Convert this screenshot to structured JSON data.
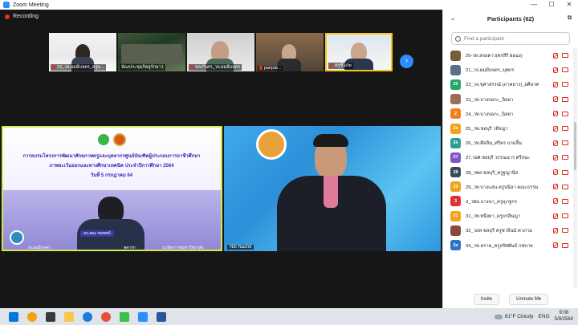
{
  "window": {
    "title": "Zoom Meeting",
    "controls": [
      "—",
      "☐",
      "✕"
    ]
  },
  "recording": {
    "label": "Recording"
  },
  "thumbnails": [
    {
      "label": "23_วจ.ผมมีบจคร_ครูบ...",
      "muted": true
    },
    {
      "label": "ห้องประชุมกิตฮูรักษา1",
      "muted": false
    },
    {
      "label": "ของวิเคร_วจ.ผมมีบจคร",
      "muted": true
    },
    {
      "label": "panpat...",
      "muted": true
    },
    {
      "label": "ครูชีวภพ",
      "muted": true
    }
  ],
  "next_page_symbol": "›",
  "shared_slide": {
    "line1": "การอบรมโครงการพัฒนาศักยภาพครูและบุคลากรศูนย์บัณฑิตผู้ประกอบการอาชีวศึกษา",
    "line2": "ภาพละเว้นออกและทางศึกษาเทคนิค ประจำปีการศึกษา 2564",
    "line3": "วันที่ 5 กรกฎาคม 64",
    "presenter_caption": "นร.ผดุง ชลทศน์",
    "ticker_left": "วจ.ผมมีบจคร",
    "ticker_mid": "พคาชา",
    "ticker_right": "นามิตรราชมหาวิทยาลัย"
  },
  "speaker": {
    "name": "Niti Nachit"
  },
  "participants_panel": {
    "title": "Participants (62)",
    "search_placeholder": "Find a participant",
    "items": [
      {
        "badge": "",
        "badge_color": "#7a5c3a",
        "name": "20-วท.สจอคาว(พรสิริ ผ่อนง)"
      },
      {
        "badge": "",
        "badge_color": "#5b6f86",
        "name": "21_วจ.ผมมีบจคร_บุพกร"
      },
      {
        "badge": "22",
        "badge_color": "#27a36a",
        "name": "22_วจ.ขุศาสรรณ์ (ภาคยาว)_ผศิลาศ"
      },
      {
        "badge": "",
        "badge_color": "#9a6e52",
        "name": "23_วท.บางบอกะ_นิลยา"
      },
      {
        "badge": "2",
        "badge_color": "#f07f1d",
        "name": "24_วท.บางบอกะ_นิลยา"
      },
      {
        "badge": "2s",
        "badge_color": "#f0a21d",
        "name": "25_วพ.ชลบุรี วสีจญา"
      },
      {
        "badge": "2e",
        "badge_color": "#2f9e8f",
        "name": "26_วท.ศิลลิน_ศรีคร บวมลิ้น"
      },
      {
        "badge": "27",
        "badge_color": "#7f58c7",
        "name": "27.วอศ.ชลบุรี วรรณนาร ศรีจนะ"
      },
      {
        "badge": "28",
        "badge_color": "#3b4a5a",
        "name": "28_วพล.ชลบุรี_ครูฐญานีส"
      },
      {
        "badge": "29",
        "badge_color": "#f0a21d",
        "name": "29_วท.บางแสน ครูนนิลา คณะธรรม"
      },
      {
        "badge": "3",
        "badge_color": "#e0312f",
        "name": "3_วพบ.บางนา_ครูญาฐกร"
      },
      {
        "badge": "31",
        "badge_color": "#f0a21d",
        "name": "31_วท.หนึงยา_ครูบรลินญา"
      },
      {
        "badge": "",
        "badge_color": "#8a4a3a",
        "name": "32_วอท.ชลบุรี ครูชาลินน์ ตาภาม"
      },
      {
        "badge": "3e",
        "badge_color": "#2c74c9",
        "name": "34_วช.ตราด_ครูสรัศพันธ์ กชบาย"
      }
    ],
    "invite_label": "Invite",
    "unmute_label": "Unmute Me"
  },
  "taskbar": {
    "weather": "81°F Cloudy",
    "lang": "ENG",
    "time": "9:08",
    "date": "5/9/2564"
  }
}
